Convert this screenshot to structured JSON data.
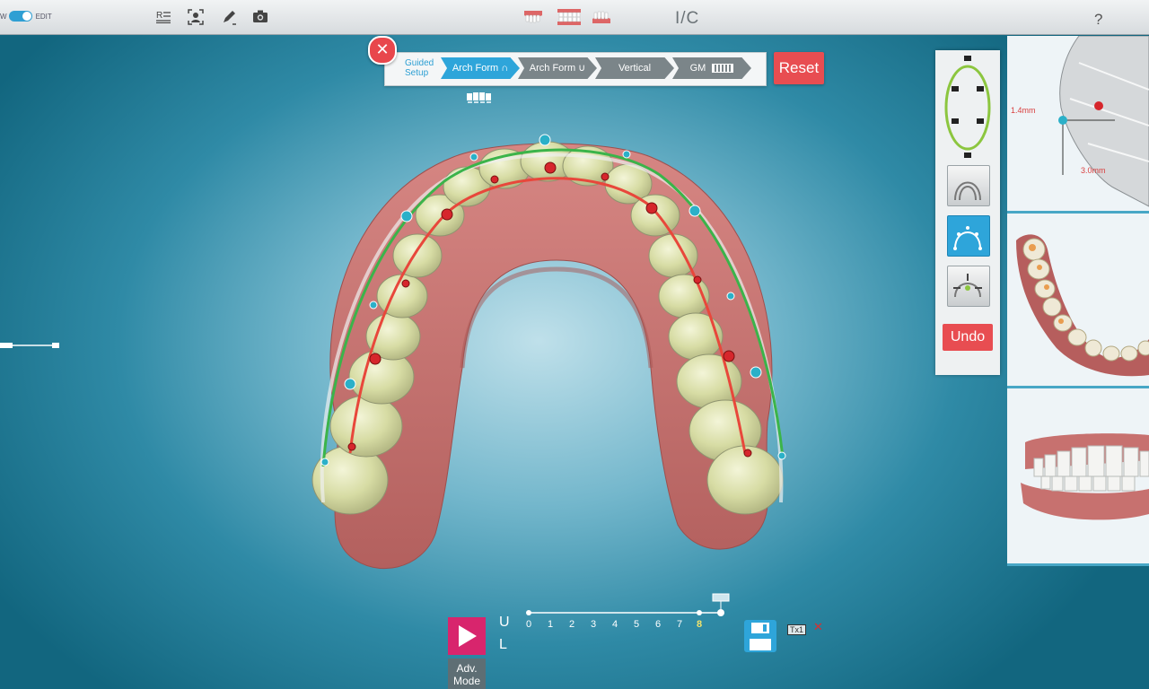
{
  "toolbar": {
    "view_label": "W",
    "edit_label": "EDIT",
    "icons": [
      "report-icon",
      "face-scan-icon",
      "pen-icon",
      "camera-icon"
    ],
    "arch_views": [
      "upper-arch-icon",
      "both-arches-icon",
      "lower-arch-icon"
    ],
    "title": "I/C",
    "help": "?"
  },
  "guided_setup": {
    "label_line1": "Guided",
    "label_line2": "Setup",
    "steps": [
      {
        "label": "Arch Form",
        "state": "active"
      },
      {
        "label": "Arch Form",
        "state": "inactive"
      },
      {
        "label": "Vertical",
        "state": "inactive"
      },
      {
        "label": "GM",
        "state": "inactive"
      }
    ],
    "reset_label": "Reset"
  },
  "tools": {
    "undo_label": "Undo"
  },
  "views": {
    "side_measure_1": "1.4mm",
    "side_measure_2": "3.0mm"
  },
  "timeline": {
    "upper_label": "U",
    "lower_label": "L",
    "stages": [
      "0",
      "1",
      "2",
      "3",
      "4",
      "5",
      "6",
      "7",
      "8"
    ],
    "current_stage": "8",
    "adv_mode_line1": "Adv.",
    "adv_mode_line2": "Mode",
    "tx_label": "Tx1"
  },
  "colors": {
    "accent_blue": "#2ea5da",
    "reset_red": "#e84d51",
    "play_pink": "#d8256d",
    "gum": "#c9716e",
    "arch_line_green": "#3bb44a",
    "arch_line_red": "#e8473b"
  }
}
